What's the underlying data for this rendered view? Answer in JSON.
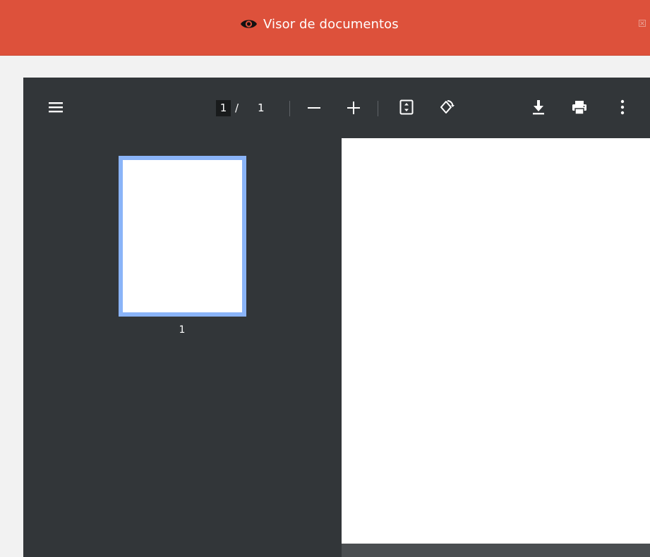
{
  "dialog": {
    "title": "Visor de documentos",
    "title_icon": "eye-icon",
    "close_icon": "close-icon",
    "header_color": "#dd513b"
  },
  "toolbar": {
    "menu_icon": "menu-icon",
    "current_page": "1",
    "page_separator": "/",
    "total_pages": "1",
    "zoom_out_icon": "zoom-out-icon",
    "zoom_in_icon": "zoom-in-icon",
    "fit_icon": "fit-to-page-icon",
    "rotate_icon": "rotate-icon",
    "download_icon": "download-icon",
    "print_icon": "print-icon",
    "more_icon": "more-vert-icon"
  },
  "sidebar": {
    "thumbnails": [
      {
        "label": "1",
        "selected": true
      }
    ],
    "selection_color": "#8ab4f8"
  }
}
